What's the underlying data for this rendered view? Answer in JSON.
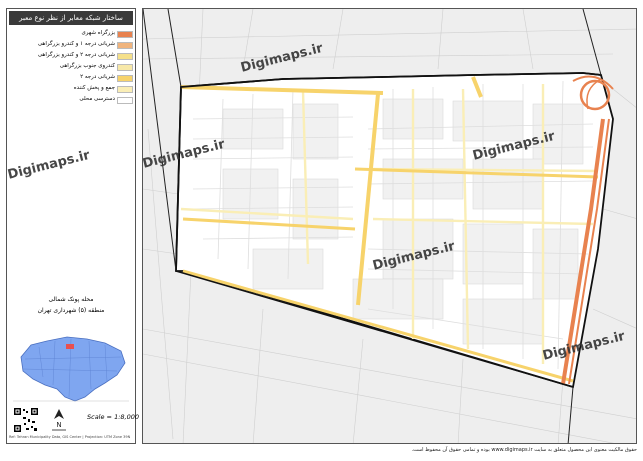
{
  "legend": {
    "title": "ساختار شبکه معابر از نظر نوع معبر",
    "items": [
      {
        "label": "بزرگراه شهری",
        "color": "#e8824f",
        "icon": "thick-orange-line"
      },
      {
        "label": "شریانی درجه ۱ و کندرو بزرگراهی",
        "color": "#f0b47d",
        "icon": "orange-line"
      },
      {
        "label": "شریانی درجه ۲ و کندرو بزرگراهی",
        "color": "#f5e08a",
        "icon": "yellow-line"
      },
      {
        "label": "کندروی جنوب بزرگراهی",
        "color": "#f7e8a8",
        "icon": "pale-yellow-line"
      },
      {
        "label": "شریانی درجه ۲",
        "color": "#f7d36b",
        "icon": "yellow-line"
      },
      {
        "label": "جمع و پخش کننده",
        "color": "#faeeb6",
        "icon": "pale-line"
      },
      {
        "label": "دسترسی محلی",
        "color": "#ffffff",
        "icon": "white-line"
      }
    ]
  },
  "district": {
    "title": "محله پونک شمالی",
    "subtitle": "منطقه (۵) شهرداری تهران"
  },
  "scale": "Scale = 1:8,000",
  "sidebar_footer": "Ref: Tehran Municipality Data, GIS Center | Projection: UTM Zone 39N",
  "copyright": "حقوق مالکیت معنوی این محصول متعلق به سایت www.digimaps.ir بوده و تمامی حقوق آن محفوظ است.",
  "watermark": "Digimaps.ir",
  "colors": {
    "highway": "#e8824f",
    "arterial": "#f7d36b",
    "collector": "#faeeb6",
    "boundary": "#111111",
    "inset_city": "#7fa6f0",
    "inset_highlight": "#e8504f"
  }
}
